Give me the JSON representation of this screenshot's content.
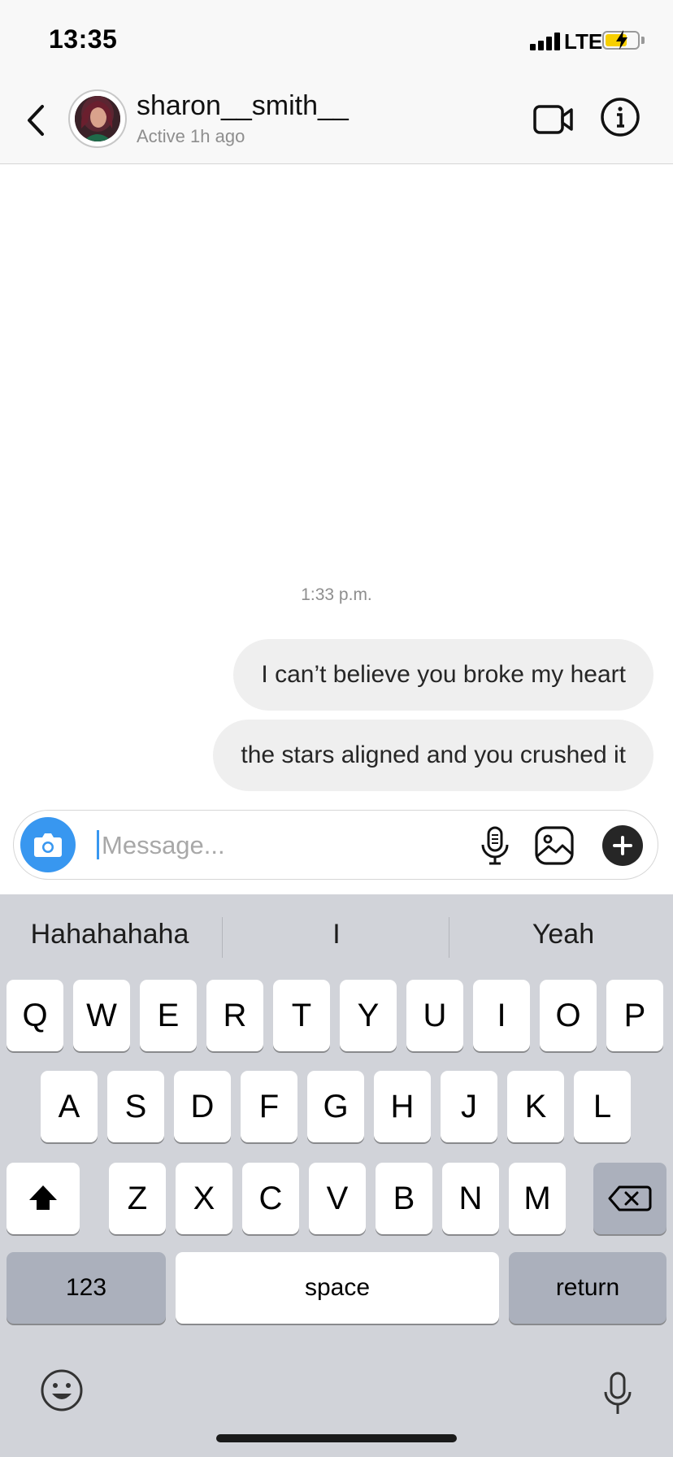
{
  "status_bar": {
    "time": "13:35",
    "network": "LTE",
    "battery_charging": true
  },
  "header": {
    "username": "sharon__smith__",
    "activity": "Active 1h ago"
  },
  "chat": {
    "timestamp": "1:33 p.m.",
    "messages": [
      {
        "text": "I can’t believe you broke my heart",
        "from": "me"
      },
      {
        "text": "the stars aligned and you crushed it",
        "from": "me"
      }
    ]
  },
  "composer": {
    "placeholder": "Message..."
  },
  "keyboard": {
    "predictions": [
      "Hahahahaha",
      "I",
      "Yeah"
    ],
    "row1": [
      "Q",
      "W",
      "E",
      "R",
      "T",
      "Y",
      "U",
      "I",
      "O",
      "P"
    ],
    "row2": [
      "A",
      "S",
      "D",
      "F",
      "G",
      "H",
      "J",
      "K",
      "L"
    ],
    "row3": [
      "Z",
      "X",
      "C",
      "V",
      "B",
      "N",
      "M"
    ],
    "numbers_label": "123",
    "space_label": "space",
    "return_label": "return"
  },
  "colors": {
    "accent": "#3897f0",
    "bubble": "#efefef",
    "keyboard_bg": "#d1d3d9"
  },
  "icons": [
    "back-chevron-icon",
    "video-call-icon",
    "info-icon",
    "camera-icon",
    "microphone-icon",
    "gallery-icon",
    "plus-icon",
    "shift-icon",
    "backspace-icon",
    "emoji-icon",
    "dictation-icon"
  ]
}
